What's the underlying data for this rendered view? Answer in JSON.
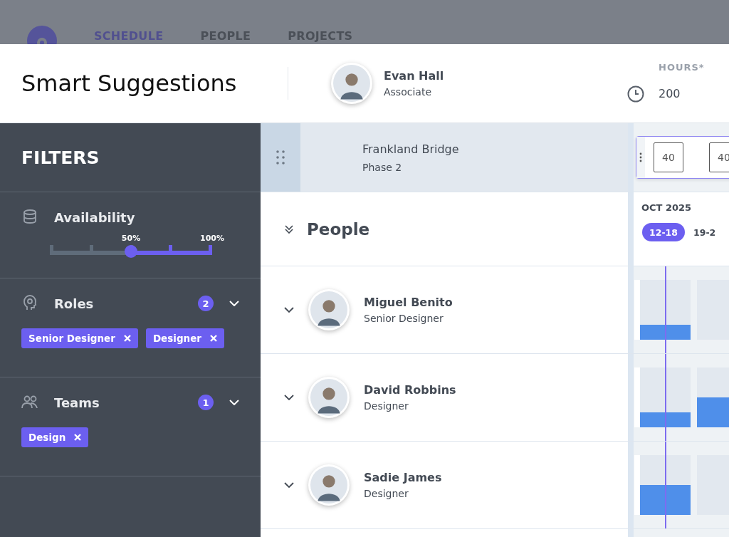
{
  "nav": {
    "tabs": [
      {
        "label": "SCHEDULE",
        "selected": true
      },
      {
        "label": "PEOPLE",
        "selected": false
      },
      {
        "label": "PROJECTS",
        "selected": false
      }
    ]
  },
  "header": {
    "title": "Smart Suggestions",
    "person": {
      "name": "Evan Hall",
      "role": "Associate"
    },
    "hours": {
      "label": "HOURS*",
      "value": "200"
    }
  },
  "filters": {
    "title": "FILTERS",
    "sections": [
      {
        "kind": "slider",
        "title": "Availability",
        "level": 0.5,
        "labels": [
          "50%",
          "100%"
        ]
      },
      {
        "kind": "tags",
        "title": "Roles",
        "count": "2",
        "tags": [
          "Senior Designer",
          "Designer"
        ]
      },
      {
        "kind": "tags",
        "title": "Teams",
        "count": "1",
        "tags": [
          "Design"
        ]
      }
    ]
  },
  "project": {
    "name": "Frankland Bridge",
    "phase": "Phase 2",
    "week_hours": [
      "40",
      "40"
    ]
  },
  "timeline": {
    "month": "OCT 2025",
    "weeks": [
      {
        "label": "12-18",
        "selected": true
      },
      {
        "label": "19-2",
        "selected": false
      }
    ]
  },
  "people": {
    "title": "People",
    "rows": [
      {
        "name": "Miguel Benito",
        "role": "Senior Designer",
        "weeks": [
          {
            "level": 0.25
          }
        ]
      },
      {
        "name": "David Robbins",
        "role": "Designer",
        "weeks": [
          {
            "level": 0.25
          },
          {
            "level": 0.5
          }
        ]
      },
      {
        "name": "Sadie James",
        "role": "Designer",
        "weeks": [
          {
            "level": 0.5
          }
        ]
      }
    ]
  }
}
